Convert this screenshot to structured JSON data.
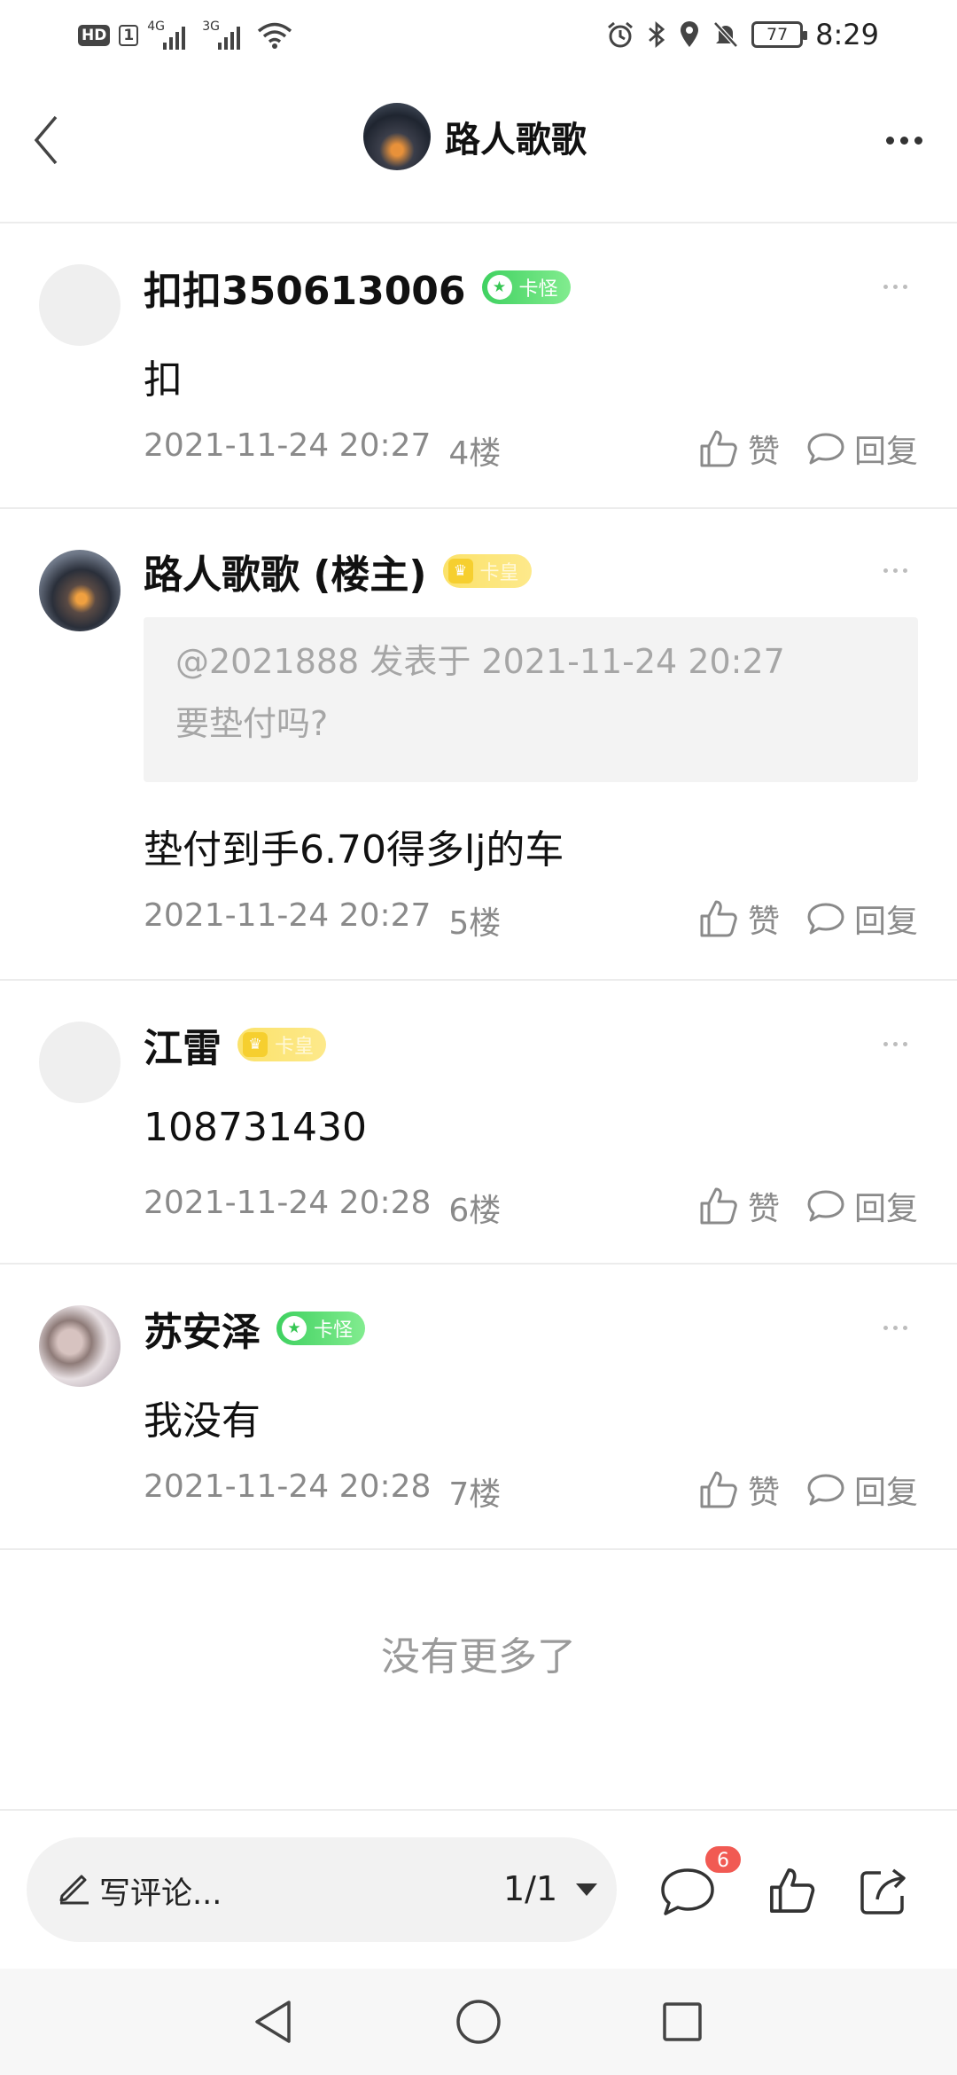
{
  "status_bar": {
    "hd": "HD",
    "sim": "1",
    "net1": "4G",
    "net2": "3G",
    "battery": "77",
    "time": "8:29"
  },
  "header": {
    "title": "路人歌歌"
  },
  "posts": [
    {
      "name": "扣扣350613006",
      "badge": "卡怪",
      "content": "扣",
      "time": "2021-11-24 20:27",
      "floor": "4楼",
      "like": "赞",
      "reply": "回复"
    },
    {
      "name": "路人歌歌 (楼主)",
      "badge": "卡皇",
      "quote_header": "@2021888 发表于 2021-11-24 20:27",
      "quote_text": "要垫付吗?",
      "content": "垫付到手6.70得多lj的车",
      "time": "2021-11-24 20:27",
      "floor": "5楼",
      "like": "赞",
      "reply": "回复"
    },
    {
      "name": "江雷",
      "badge": "卡皇",
      "content": "108731430",
      "time": "2021-11-24 20:28",
      "floor": "6楼",
      "like": "赞",
      "reply": "回复"
    },
    {
      "name": "苏安泽",
      "badge": "卡怪",
      "content": "我没有",
      "time": "2021-11-24 20:28",
      "floor": "7楼",
      "like": "赞",
      "reply": "回复"
    }
  ],
  "footer_note": "没有更多了",
  "bottom_bar": {
    "comment_placeholder": "写评论...",
    "page": "1/1",
    "comment_count": "6"
  },
  "colors": {
    "badge_green": "#3fd160",
    "badge_gold": "#f6cf2f",
    "count_badge": "#f15a53"
  }
}
